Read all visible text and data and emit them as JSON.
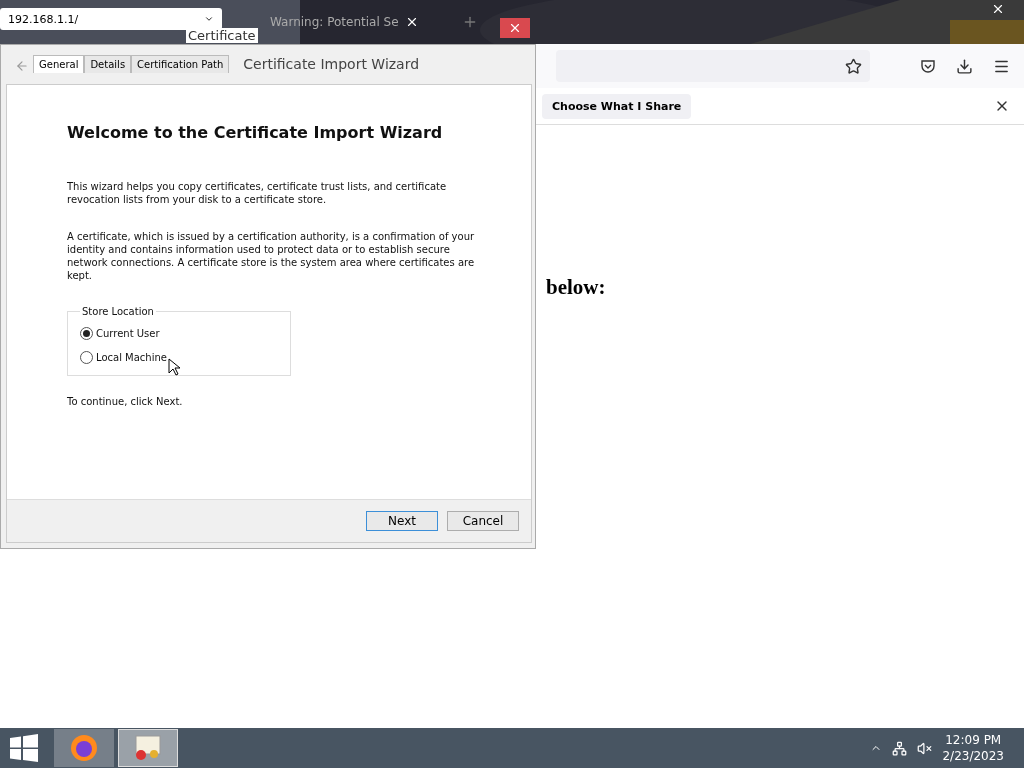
{
  "address_popup": {
    "value": "192.168.1.1/"
  },
  "browser": {
    "tab": {
      "title": "Warning: Potential Se"
    },
    "notification": {
      "button": "Choose What I Share"
    },
    "page": {
      "heading": "below:"
    }
  },
  "certificate_window": {
    "title": "Certificate",
    "tabs": [
      {
        "label": "General",
        "selected": true
      },
      {
        "label": "Details",
        "selected": false
      },
      {
        "label": "Certification Path",
        "selected": false
      }
    ]
  },
  "wizard": {
    "title": "Certificate Import Wizard",
    "heading": "Welcome to the Certificate Import Wizard",
    "paragraphs": [
      "This wizard helps you copy certificates, certificate trust lists, and certificate revocation lists from your disk to a certificate store.",
      "A certificate, which is issued by a certification authority, is a confirmation of your identity and contains information used to protect data or to establish secure network connections. A certificate store is the system area where certificates are kept."
    ],
    "store_location": {
      "legend": "Store Location",
      "options": [
        {
          "label": "Current User",
          "selected": true
        },
        {
          "label": "Local Machine",
          "selected": false
        }
      ]
    },
    "hint": "To continue, click Next.",
    "buttons": [
      {
        "label": "Next",
        "default": true
      },
      {
        "label": "Cancel",
        "default": false
      }
    ]
  },
  "taskbar": {
    "apps": [
      {
        "kind": "browser",
        "active": false
      },
      {
        "kind": "certificate",
        "active": true
      }
    ],
    "time": "12:09 PM",
    "date": "2/23/2023"
  }
}
